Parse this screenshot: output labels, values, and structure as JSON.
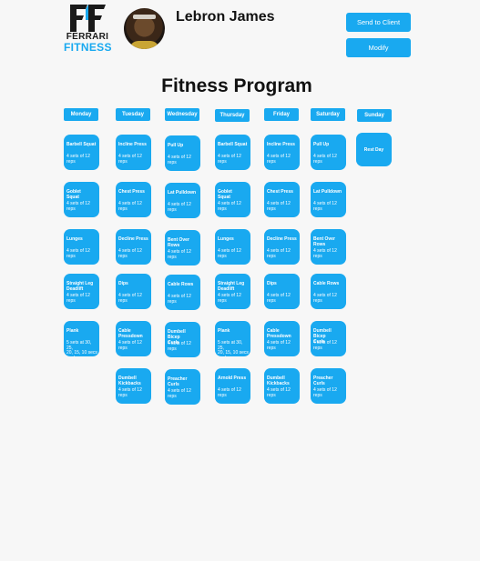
{
  "header": {
    "logo_line1": "FERRARI",
    "logo_line2": "FITNESS",
    "client_name": "Lebron James",
    "send_button": "Send to Client",
    "modify_button": "Modify"
  },
  "colors": {
    "accent": "#19a9f0",
    "text": "#111111",
    "background": "#f7f7f7"
  },
  "program": {
    "title": "Fitness Program",
    "days": [
      {
        "label": "Monday",
        "exercises": [
          {
            "name": "Barbell Squat",
            "detail": "4 sets of 12\nreps"
          },
          {
            "name": "Goblet\nSquat",
            "detail": "4 sets of 12\nreps"
          },
          {
            "name": "Lunges",
            "detail": "4 sets of 12\nreps"
          },
          {
            "name": "Straight Leg\nDeadlift",
            "detail": "4 sets of 12\nreps"
          },
          {
            "name": "Plank",
            "detail": "5 sets at 30, 25,\n20, 15, 10 secs\neach"
          }
        ]
      },
      {
        "label": "Tuesday",
        "exercises": [
          {
            "name": "Incline Press",
            "detail": "4 sets of 12\nreps"
          },
          {
            "name": "Chest Press",
            "detail": "4 sets of 12\nreps"
          },
          {
            "name": "Decline Press",
            "detail": "4 sets of 12\nreps"
          },
          {
            "name": "Dips",
            "detail": "4 sets of 12\nreps"
          },
          {
            "name": "Cable\nPressdown",
            "detail": "4 sets of 12\nreps"
          },
          {
            "name": "Dumbell\nKickbacks",
            "detail": "4 sets of 12\nreps"
          }
        ]
      },
      {
        "label": "Wednesday",
        "exercises": [
          {
            "name": "Pull Up",
            "detail": "4 sets of 12\nreps"
          },
          {
            "name": "Lat Pulldown",
            "detail": "4 sets of 12\nreps"
          },
          {
            "name": "Bent Over Rows",
            "detail": "4 sets of 12\nreps"
          },
          {
            "name": "Cable Rows",
            "detail": "4 sets of 12\nreps"
          },
          {
            "name": "Dumbell Bicep\nCurls",
            "detail": "4 sets of 12\nreps"
          },
          {
            "name": "Preacher Curls",
            "detail": "4 sets of 12\nreps"
          }
        ]
      },
      {
        "label": "Thursday",
        "exercises": [
          {
            "name": "Barbell Squat",
            "detail": "4 sets of 12\nreps"
          },
          {
            "name": "Goblet\nSquat",
            "detail": "4 sets of 12\nreps"
          },
          {
            "name": "Lunges",
            "detail": "4 sets of 12\nreps"
          },
          {
            "name": "Straight Leg\nDeadlift",
            "detail": "4 sets of 12\nreps"
          },
          {
            "name": "Plank",
            "detail": "5 sets at 30, 25,\n20, 15, 10 secs\neach"
          },
          {
            "name": "Arnold Press",
            "detail": "4 sets of 12\nreps"
          }
        ]
      },
      {
        "label": "Friday",
        "exercises": [
          {
            "name": "Incline Press",
            "detail": "4 sets of 12\nreps"
          },
          {
            "name": "Chest Press",
            "detail": "4 sets of 12\nreps"
          },
          {
            "name": "Decline Press",
            "detail": "4 sets of 12\nreps"
          },
          {
            "name": "Dips",
            "detail": "4 sets of 12\nreps"
          },
          {
            "name": "Cable\nPressdown",
            "detail": "4 sets of 12\nreps"
          },
          {
            "name": "Dumbell\nKickbacks",
            "detail": "4 sets of 12\nreps"
          }
        ]
      },
      {
        "label": "Saturday",
        "exercises": [
          {
            "name": "Pull Up",
            "detail": "4 sets of 12\nreps"
          },
          {
            "name": "Lat Pulldown",
            "detail": "4 sets of 12\nreps"
          },
          {
            "name": "Bent Over Rows",
            "detail": "4 sets of 12\nreps"
          },
          {
            "name": "Cable Rows",
            "detail": "4 sets of 12\nreps"
          },
          {
            "name": "Dumbell Bicep\nCurls",
            "detail": "4 sets of 12\nreps"
          },
          {
            "name": "Preacher Curls",
            "detail": "4 sets of 12\nreps"
          }
        ]
      },
      {
        "label": "Sunday",
        "rest_label": "Rest Day",
        "exercises": []
      }
    ]
  }
}
